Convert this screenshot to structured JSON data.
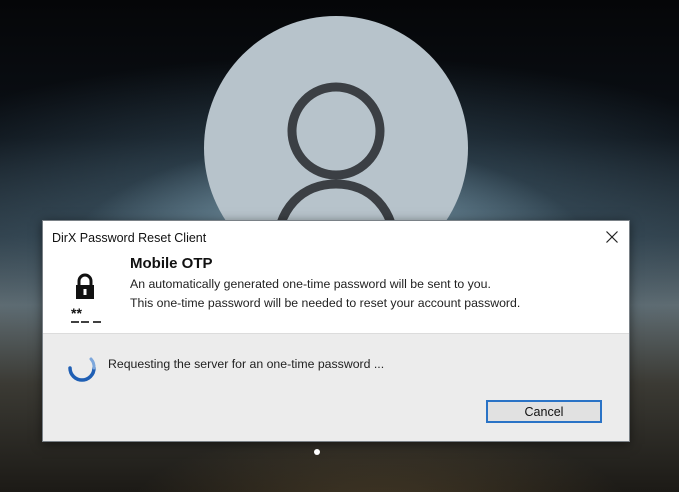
{
  "dialog": {
    "title": "DirX Password Reset Client",
    "heading": "Mobile OTP",
    "description_line1": "An automatically generated one-time password will be sent to you.",
    "description_line2": "This one-time password will be needed to reset your account password.",
    "status": "Requesting the server for an one-time password ...",
    "cancel_label": "Cancel",
    "close_icon": "close-icon",
    "lock_icon": "lock-password-icon",
    "spinner_icon": "loading-spinner-icon"
  },
  "background": {
    "avatar_icon": "user-avatar-icon",
    "page_indicator": "page-dot"
  },
  "colors": {
    "accent": "#2a73c6",
    "dialog_body": "#ececec",
    "avatar": "#b7c3cb"
  }
}
